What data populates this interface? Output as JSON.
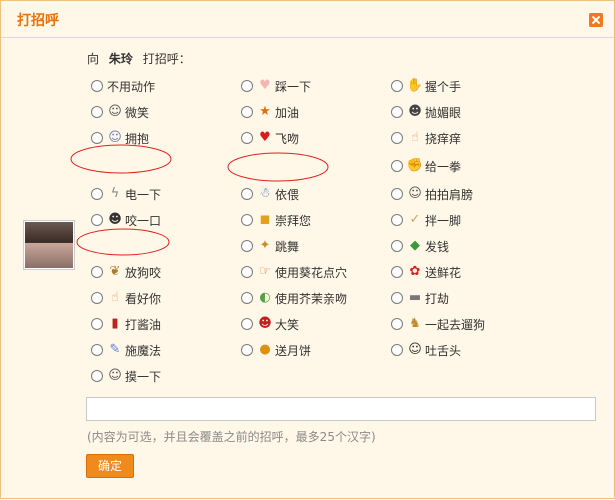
{
  "dialog": {
    "title": "打招呼",
    "greeting": {
      "prefix": "向",
      "name": "朱玲",
      "suffix": "打招呼："
    },
    "actions": [
      {
        "label": "不用动作",
        "icon": ""
      },
      {
        "label": "踩一下",
        "icon": "foot-icon"
      },
      {
        "label": "握个手",
        "icon": "handshake-icon"
      },
      {
        "label": "微笑",
        "icon": "smile-icon"
      },
      {
        "label": "加油",
        "icon": "cheer-icon"
      },
      {
        "label": "抛媚眼",
        "icon": "wink-icon"
      },
      {
        "label": "拥抱",
        "icon": "hug-icon"
      },
      {
        "label": "飞吻",
        "icon": "kiss-icon"
      },
      {
        "label": "挠痒痒",
        "icon": "tickle-icon"
      },
      {
        "label": "给一拳",
        "icon": "fist-icon"
      },
      {
        "label": "电一下",
        "icon": "lightning-icon"
      },
      {
        "label": "依偎",
        "icon": "cuddle-icon"
      },
      {
        "label": "拍拍肩膀",
        "icon": "pat-icon"
      },
      {
        "label": "咬一口",
        "icon": "bite-icon"
      },
      {
        "label": "崇拜您",
        "icon": "worship-icon"
      },
      {
        "label": "拌一脚",
        "icon": "trip-icon"
      },
      {
        "label": "跳舞",
        "icon": "dance-icon"
      },
      {
        "label": "发钱",
        "icon": "money-icon"
      },
      {
        "label": "放狗咬",
        "icon": "dog-icon"
      },
      {
        "label": "使用葵花点穴",
        "icon": "point-icon"
      },
      {
        "label": "送鲜花",
        "icon": "flower-icon"
      },
      {
        "label": "看好你",
        "icon": "thumbs-up-icon"
      },
      {
        "label": "使用芥茉亲吻",
        "icon": "wasabi-icon"
      },
      {
        "label": "打劫",
        "icon": "gun-icon"
      },
      {
        "label": "打酱油",
        "icon": "soy-sauce-icon"
      },
      {
        "label": "大笑",
        "icon": "laugh-icon"
      },
      {
        "label": "一起去遛狗",
        "icon": "walk-dog-icon"
      },
      {
        "label": "施魔法",
        "icon": "magic-wand-icon"
      },
      {
        "label": "送月饼",
        "icon": "mooncake-icon"
      },
      {
        "label": "吐舌头",
        "icon": "tongue-icon"
      },
      {
        "label": "摸一下",
        "icon": "touch-icon"
      }
    ],
    "message_placeholder": "",
    "hint": "(内容为可选，并且会覆盖之前的招呼，最多25个汉字)",
    "ok_label": "确定"
  }
}
